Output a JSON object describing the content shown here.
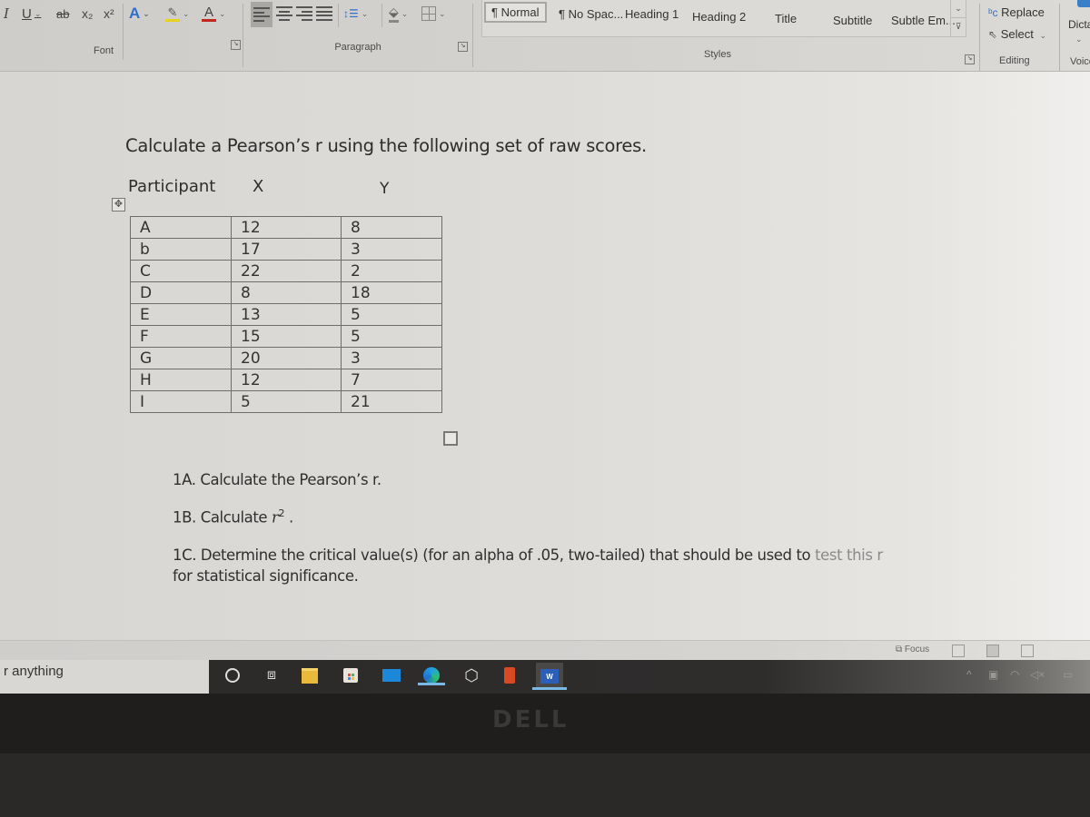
{
  "ribbon": {
    "font_group": {
      "label": "Font",
      "buttons": [
        {
          "name": "italic-button",
          "glyph": "I"
        },
        {
          "name": "underline-button",
          "glyph": "U"
        },
        {
          "name": "strikethrough-button",
          "glyph": "ab"
        },
        {
          "name": "subscript-button",
          "glyph": "x₂"
        },
        {
          "name": "superscript-button",
          "glyph": "x²"
        },
        {
          "name": "text-effects-button",
          "glyph": "A"
        },
        {
          "name": "highlight-button",
          "glyph": "✎"
        },
        {
          "name": "font-color-button",
          "glyph": "A"
        }
      ],
      "colors": {
        "text_effects": "#2f6fd0",
        "highlight": "#e8d21a",
        "font_color": "#c0281e"
      }
    },
    "paragraph_group": {
      "label": "Paragraph",
      "active_alignment": "align-left"
    },
    "styles_group": {
      "label": "Styles",
      "items": [
        "¶ Normal",
        "¶ No Spac...",
        "Heading 1",
        "Heading 2",
        "Title",
        "Subtitle",
        "Subtle Em..."
      ],
      "selected": "¶ Normal"
    },
    "editing_group": {
      "label": "Editing",
      "replace_label": "Replace",
      "select_label": "Select"
    },
    "voice_group": {
      "label": "Voice",
      "dictate_label": "Dicta"
    }
  },
  "document": {
    "title": "Calculate a Pearson’s r using the following set of raw scores.",
    "headers": {
      "participant": "Participant",
      "x": "X",
      "y": "Y"
    },
    "rows": [
      {
        "participant": "A",
        "x": "12",
        "y": "8"
      },
      {
        "participant": "b",
        "x": "17",
        "y": "3"
      },
      {
        "participant": "C",
        "x": "22",
        "y": "2"
      },
      {
        "participant": "D",
        "x": "8",
        "y": "18"
      },
      {
        "participant": "E",
        "x": "13",
        "y": "5"
      },
      {
        "participant": "F",
        "x": "15",
        "y": "5"
      },
      {
        "participant": "G",
        "x": "20",
        "y": "3"
      },
      {
        "participant": "H",
        "x": "12",
        "y": "7"
      },
      {
        "participant": "I",
        "x": "5",
        "y": "21"
      }
    ],
    "questions": {
      "q1a": "1A. Calculate the Pearson’s r.",
      "q1b_prefix": "1B. Calculate ",
      "q1b_var": "r",
      "q1b_exp": "2",
      "q1b_suffix": " .",
      "q1c_line1_main": "1C. Determine the critical value(s) (for an alpha of .05, two-tailed) that should be used to ",
      "q1c_line1_faded": "test this r",
      "q1c_line2": "for statistical significance."
    }
  },
  "statusbar": {
    "focus_label": "Focus"
  },
  "taskbar": {
    "search_text": "r anything",
    "apps": [
      {
        "name": "cortana",
        "active": false
      },
      {
        "name": "task-view",
        "active": false
      },
      {
        "name": "file-explorer",
        "active": false
      },
      {
        "name": "microsoft-store",
        "active": false
      },
      {
        "name": "mail",
        "active": false
      },
      {
        "name": "edge",
        "active": true
      },
      {
        "name": "3d-viewer",
        "active": false
      },
      {
        "name": "office",
        "active": false
      },
      {
        "name": "word",
        "active": true
      }
    ],
    "word_label": "W"
  },
  "bezel": {
    "brand": "DELL"
  }
}
